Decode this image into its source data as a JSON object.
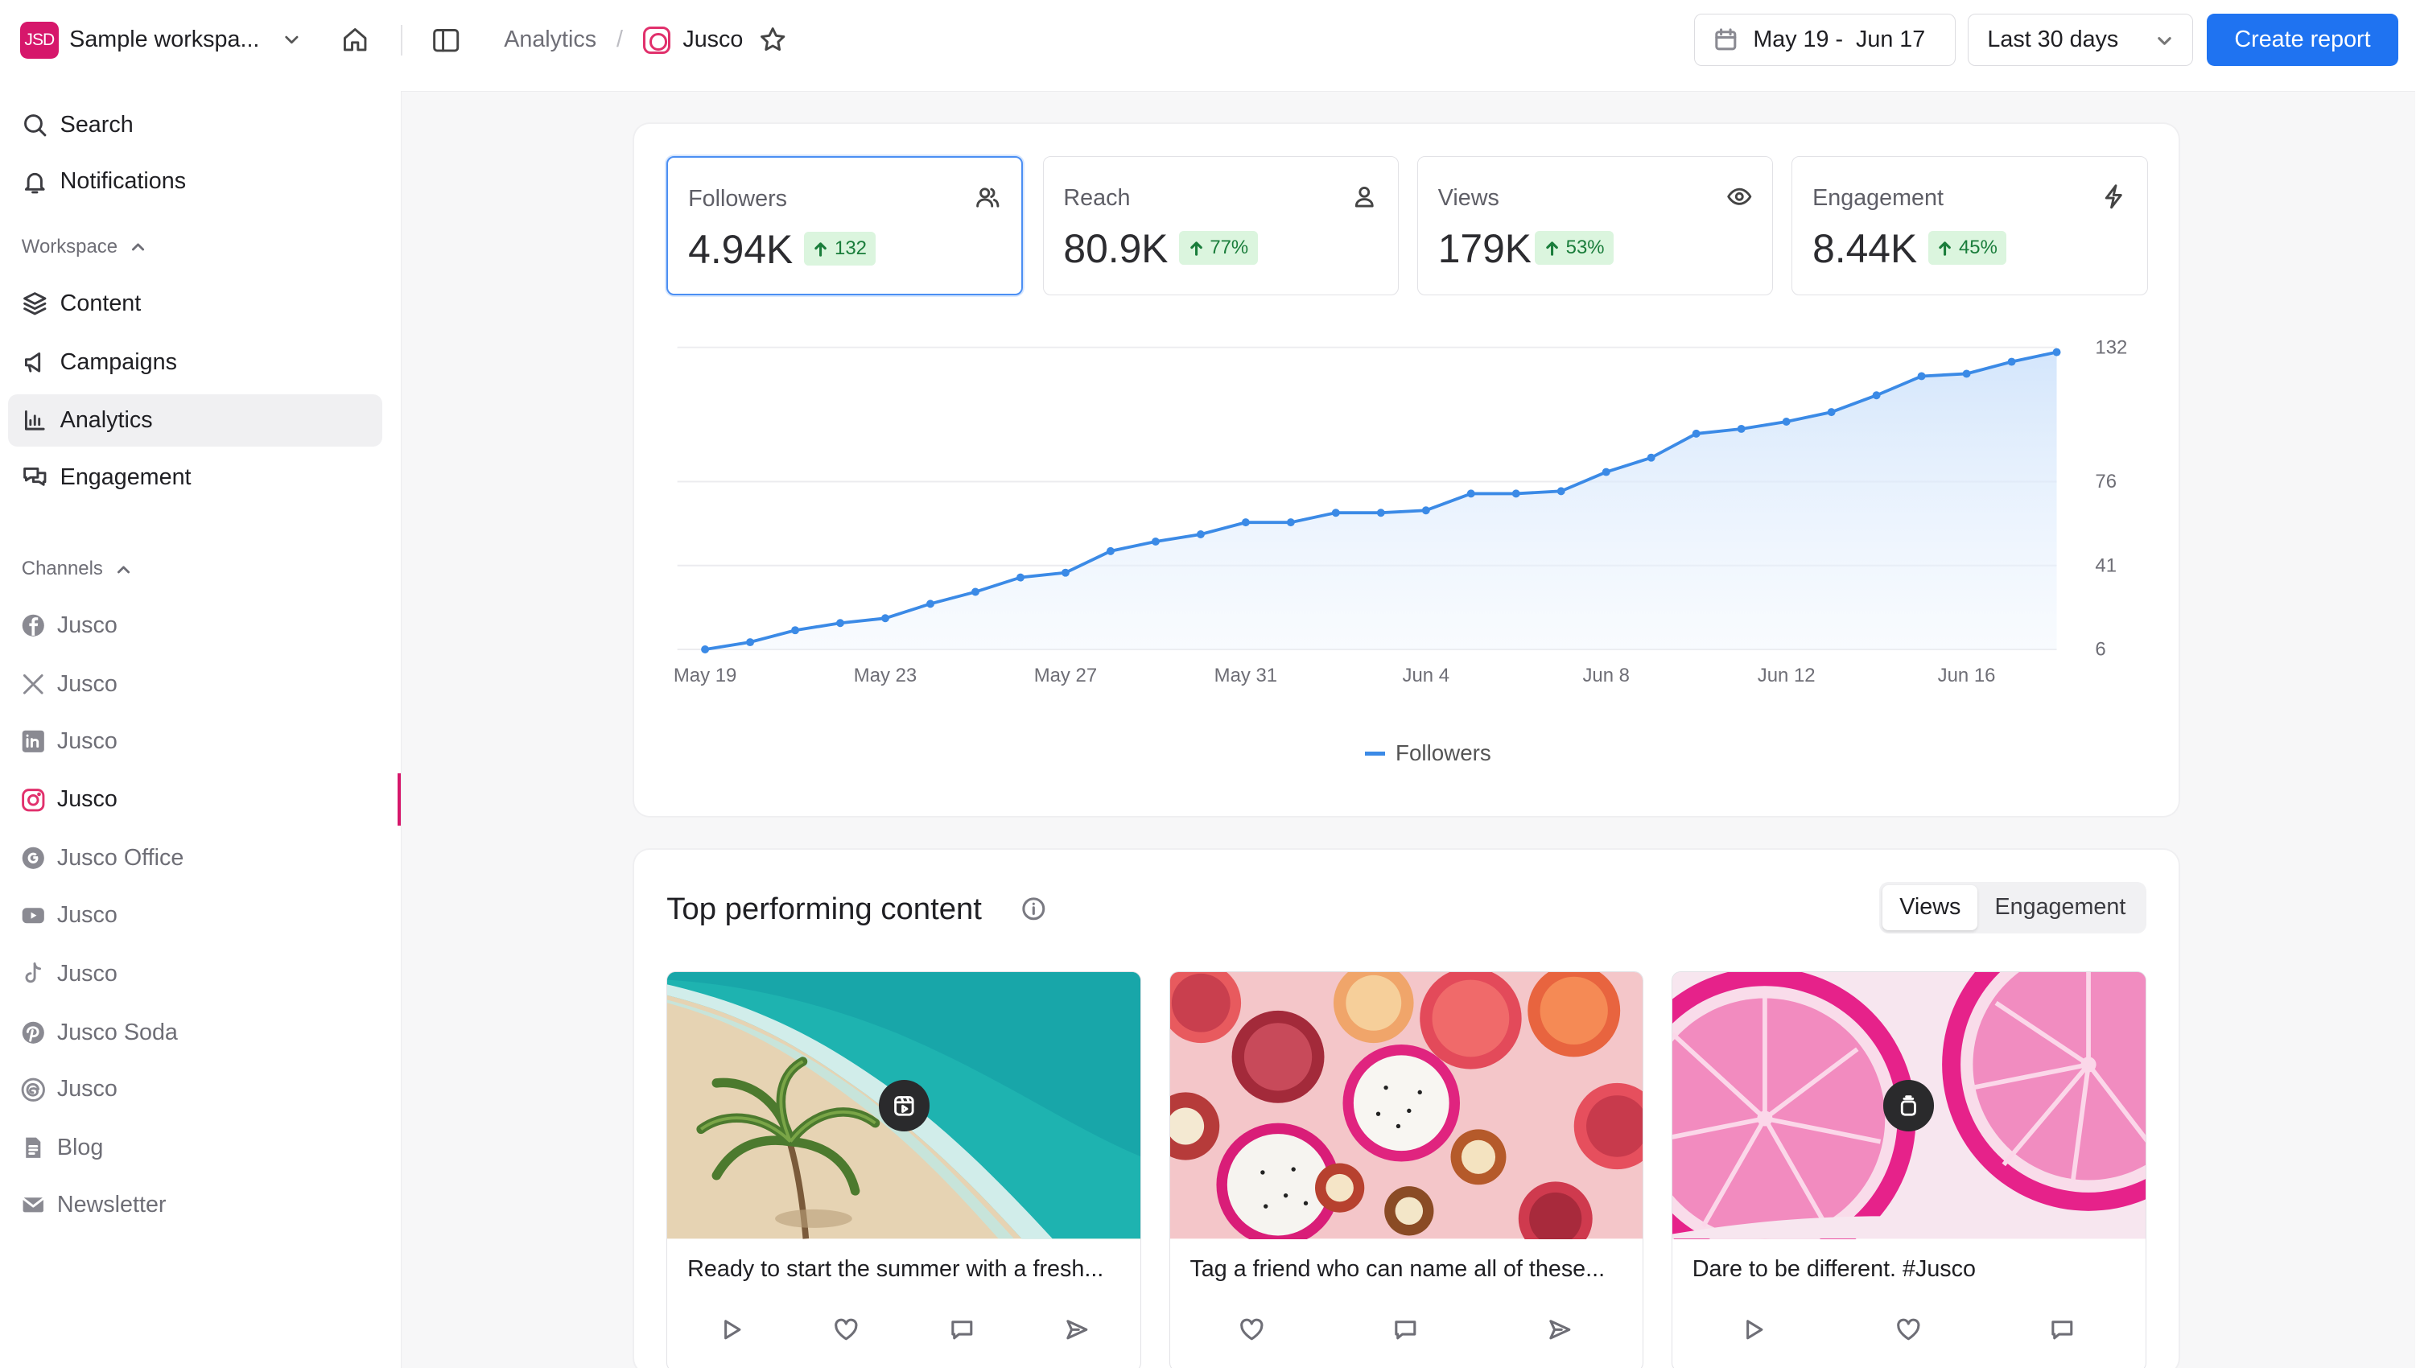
{
  "workspace": {
    "logo_text": "JSD",
    "name": "Sample workspa..."
  },
  "breadcrumb": {
    "section": "Analytics",
    "separator": "/",
    "page": "Jusco"
  },
  "toolbar": {
    "date_range": "May 19 -  Jun 17",
    "preset": "Last 30 days",
    "create_label": "Create report"
  },
  "sidebar": {
    "top": [
      {
        "label": "Search",
        "icon": "search-icon"
      },
      {
        "label": "Notifications",
        "icon": "bell-icon"
      }
    ],
    "workspace_label": "Workspace",
    "workspace_items": [
      {
        "label": "Content",
        "icon": "layers-icon"
      },
      {
        "label": "Campaigns",
        "icon": "megaphone-icon"
      },
      {
        "label": "Analytics",
        "icon": "bar-chart-icon"
      },
      {
        "label": "Engagement",
        "icon": "chat-icon"
      }
    ],
    "channels_label": "Channels",
    "channels": [
      {
        "label": "Jusco",
        "icon": "facebook-icon"
      },
      {
        "label": "Jusco",
        "icon": "x-icon"
      },
      {
        "label": "Jusco",
        "icon": "linkedin-icon"
      },
      {
        "label": "Jusco",
        "icon": "instagram-icon"
      },
      {
        "label": "Jusco Office",
        "icon": "google-icon"
      },
      {
        "label": "Jusco",
        "icon": "youtube-icon"
      },
      {
        "label": "Jusco",
        "icon": "tiktok-icon"
      },
      {
        "label": "Jusco Soda",
        "icon": "pinterest-icon"
      },
      {
        "label": "Jusco",
        "icon": "threads-icon"
      },
      {
        "label": "Blog",
        "icon": "document-icon"
      },
      {
        "label": "Newsletter",
        "icon": "mail-icon"
      }
    ]
  },
  "metrics": [
    {
      "label": "Followers",
      "value": "4.94K",
      "change": "132",
      "icon": "users-icon"
    },
    {
      "label": "Reach",
      "value": "80.9K",
      "change": "77%",
      "icon": "user-icon"
    },
    {
      "label": "Views",
      "value": "179K",
      "change": "53%",
      "icon": "eye-icon"
    },
    {
      "label": "Engagement",
      "value": "8.44K",
      "change": "45%",
      "icon": "lightning-icon"
    }
  ],
  "chart_data": {
    "type": "area",
    "series": [
      {
        "name": "Followers",
        "values": [
          6,
          9,
          14,
          17,
          19,
          25,
          30,
          36,
          38,
          47,
          51,
          54,
          59,
          59,
          63,
          63,
          64,
          71,
          71,
          72,
          80,
          86,
          96,
          98,
          101,
          105,
          112,
          120,
          121,
          126,
          130
        ]
      }
    ],
    "x": [
      "May 19",
      "May 20",
      "May 21",
      "May 22",
      "May 23",
      "May 24",
      "May 25",
      "May 26",
      "May 27",
      "May 28",
      "May 29",
      "May 30",
      "May 31",
      "Jun 1",
      "Jun 2",
      "Jun 3",
      "Jun 4",
      "Jun 5",
      "Jun 6",
      "Jun 7",
      "Jun 8",
      "Jun 9",
      "Jun 10",
      "Jun 11",
      "Jun 12",
      "Jun 13",
      "Jun 14",
      "Jun 15",
      "Jun 16",
      "Jun 17",
      "Jun 18"
    ],
    "x_tick_labels": [
      "May 19",
      "May 23",
      "May 27",
      "May 31",
      "Jun 4",
      "Jun 8",
      "Jun 12",
      "Jun 16"
    ],
    "y_tick_labels": [
      "132",
      "76",
      "41",
      "6"
    ],
    "ylim": [
      6,
      132
    ],
    "grid": true,
    "legend": "bottom",
    "color": "#3b8ae6"
  },
  "top_content": {
    "title": "Top performing content",
    "tabs": [
      "Views",
      "Engagement"
    ],
    "posts": [
      {
        "caption": "Ready to start the summer with a fresh...",
        "type_icon": "reel-icon"
      },
      {
        "caption": "Tag a friend who can name all of these..."
      },
      {
        "caption": "Dare to be different. #Jusco",
        "type_icon": "carousel-icon"
      }
    ]
  },
  "colors": {
    "accent": "#1f73f1",
    "brand": "#d6176b",
    "positive": "#1a7d3b"
  }
}
